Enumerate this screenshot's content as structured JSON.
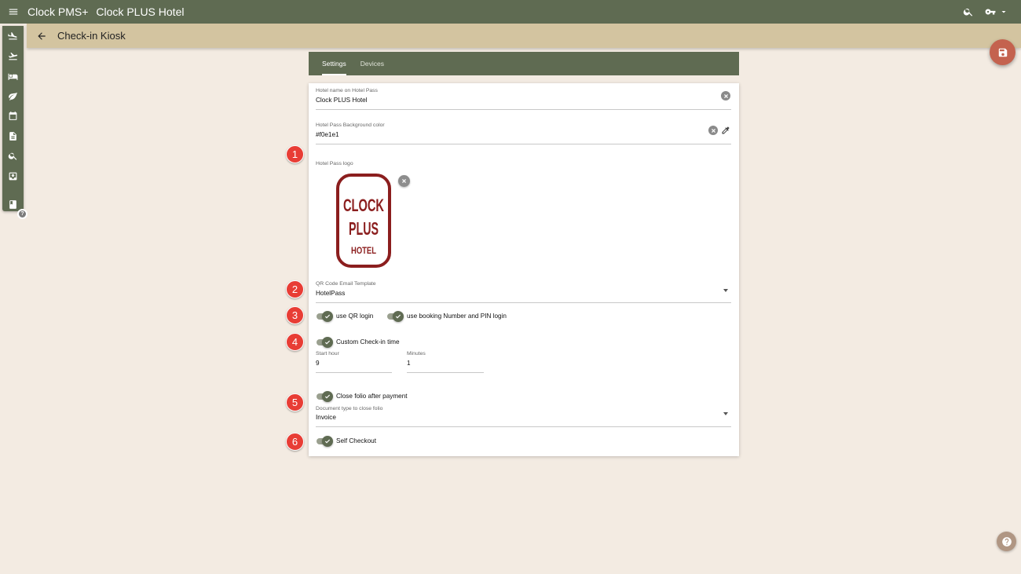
{
  "topbar": {
    "app_name": "Clock PMS+",
    "hotel_name": "Clock PLUS Hotel",
    "icons": [
      "menu-icon",
      "search-icon",
      "key-icon",
      "arrow-drop-down-icon"
    ]
  },
  "subbar": {
    "title": "Check-in Kiosk",
    "back_icon": "arrow-back-icon"
  },
  "rail": {
    "items": [
      {
        "icon": "flight-land-icon"
      },
      {
        "icon": "flight-takeoff-icon"
      },
      {
        "icon": "hotel-bed-icon"
      },
      {
        "icon": "leaf-icon"
      },
      {
        "icon": "calendar-icon"
      },
      {
        "icon": "document-icon"
      },
      {
        "icon": "search-icon"
      },
      {
        "icon": "inbox-download-icon"
      },
      {
        "icon": "book-icon"
      }
    ]
  },
  "tabs": [
    {
      "label": "Settings",
      "active": true
    },
    {
      "label": "Devices",
      "active": false
    }
  ],
  "form": {
    "hotel_name": {
      "label": "Hotel name on Hotel Pass",
      "value": "Clock PLUS Hotel"
    },
    "bg_color": {
      "label": "Hotel Pass Background color",
      "value": "#f0e1e1"
    },
    "logo": {
      "label": "Hotel Pass logo",
      "logo_lines": [
        "CLOCK",
        "PLUS",
        "HOTEL"
      ],
      "logo_color": "#8b1e1e"
    },
    "qr_template": {
      "label": "QR Code Email Template",
      "value": "HotelPass"
    },
    "use_qr": {
      "label": "use QR login",
      "on": true
    },
    "use_booking": {
      "label": "use booking Number and PIN login",
      "on": true
    },
    "custom_checkin": {
      "label": "Custom Check-in time",
      "on": true
    },
    "start_hour": {
      "label": "Start hour",
      "value": "9"
    },
    "minutes": {
      "label": "Minutes",
      "value": "1"
    },
    "close_folio": {
      "label": "Close folio after payment",
      "on": true
    },
    "doc_type": {
      "label": "Document type to close folio",
      "value": "Invoice"
    },
    "self_checkout": {
      "label": "Self Checkout",
      "on": true
    }
  },
  "markers": [
    "1",
    "2",
    "3",
    "4",
    "5",
    "6"
  ],
  "rail_badge": "?",
  "colors": {
    "topbar": "#5f6b52",
    "subbar": "#d3c4a0",
    "background": "#f3ebe2",
    "save_fab": "#c4624e",
    "marker": "#e83d35"
  }
}
